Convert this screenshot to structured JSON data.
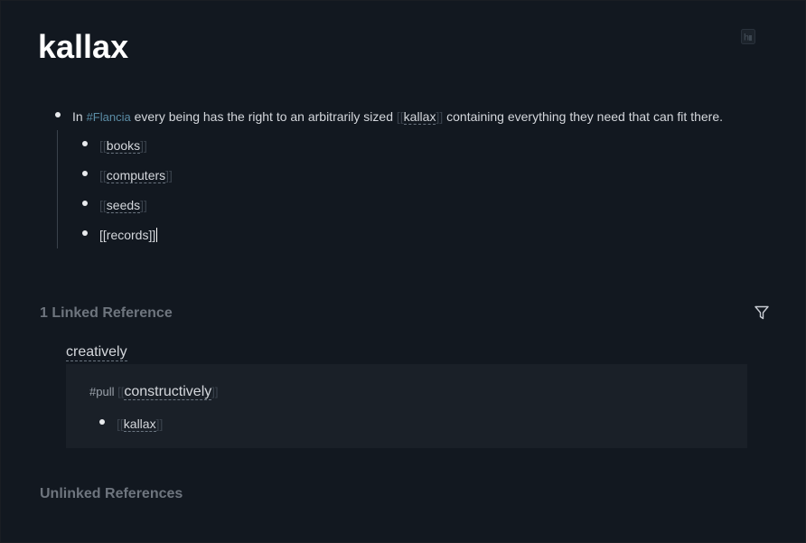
{
  "page": {
    "title": "kallax"
  },
  "blocks": {
    "main": {
      "prefix": "In ",
      "tag": "#Flancia",
      "middle": " every being has the right to an arbitrarily sized ",
      "ref": "kallax",
      "suffix": " containing everything they need that can fit there."
    },
    "children": [
      {
        "ref": "books"
      },
      {
        "ref": "computers"
      },
      {
        "ref": "seeds"
      },
      {
        "raw": "[[records]]"
      }
    ]
  },
  "brackets": {
    "open": "[[",
    "close": "]]"
  },
  "linked_refs": {
    "title": "1 Linked Reference",
    "source_page": "creatively",
    "tag": "#pull",
    "block_ref": "constructively",
    "child_ref": "kallax"
  },
  "unlinked_refs": {
    "title": "Unlinked References"
  },
  "icons": {
    "heading_toggle": "heading-toggle-icon",
    "filter": "filter-icon"
  },
  "colors": {
    "background": "#121820",
    "title": "#ffffff",
    "tag": "#5b8da6",
    "muted_heading": "#6e757e",
    "ref_panel": "#1a2028"
  }
}
